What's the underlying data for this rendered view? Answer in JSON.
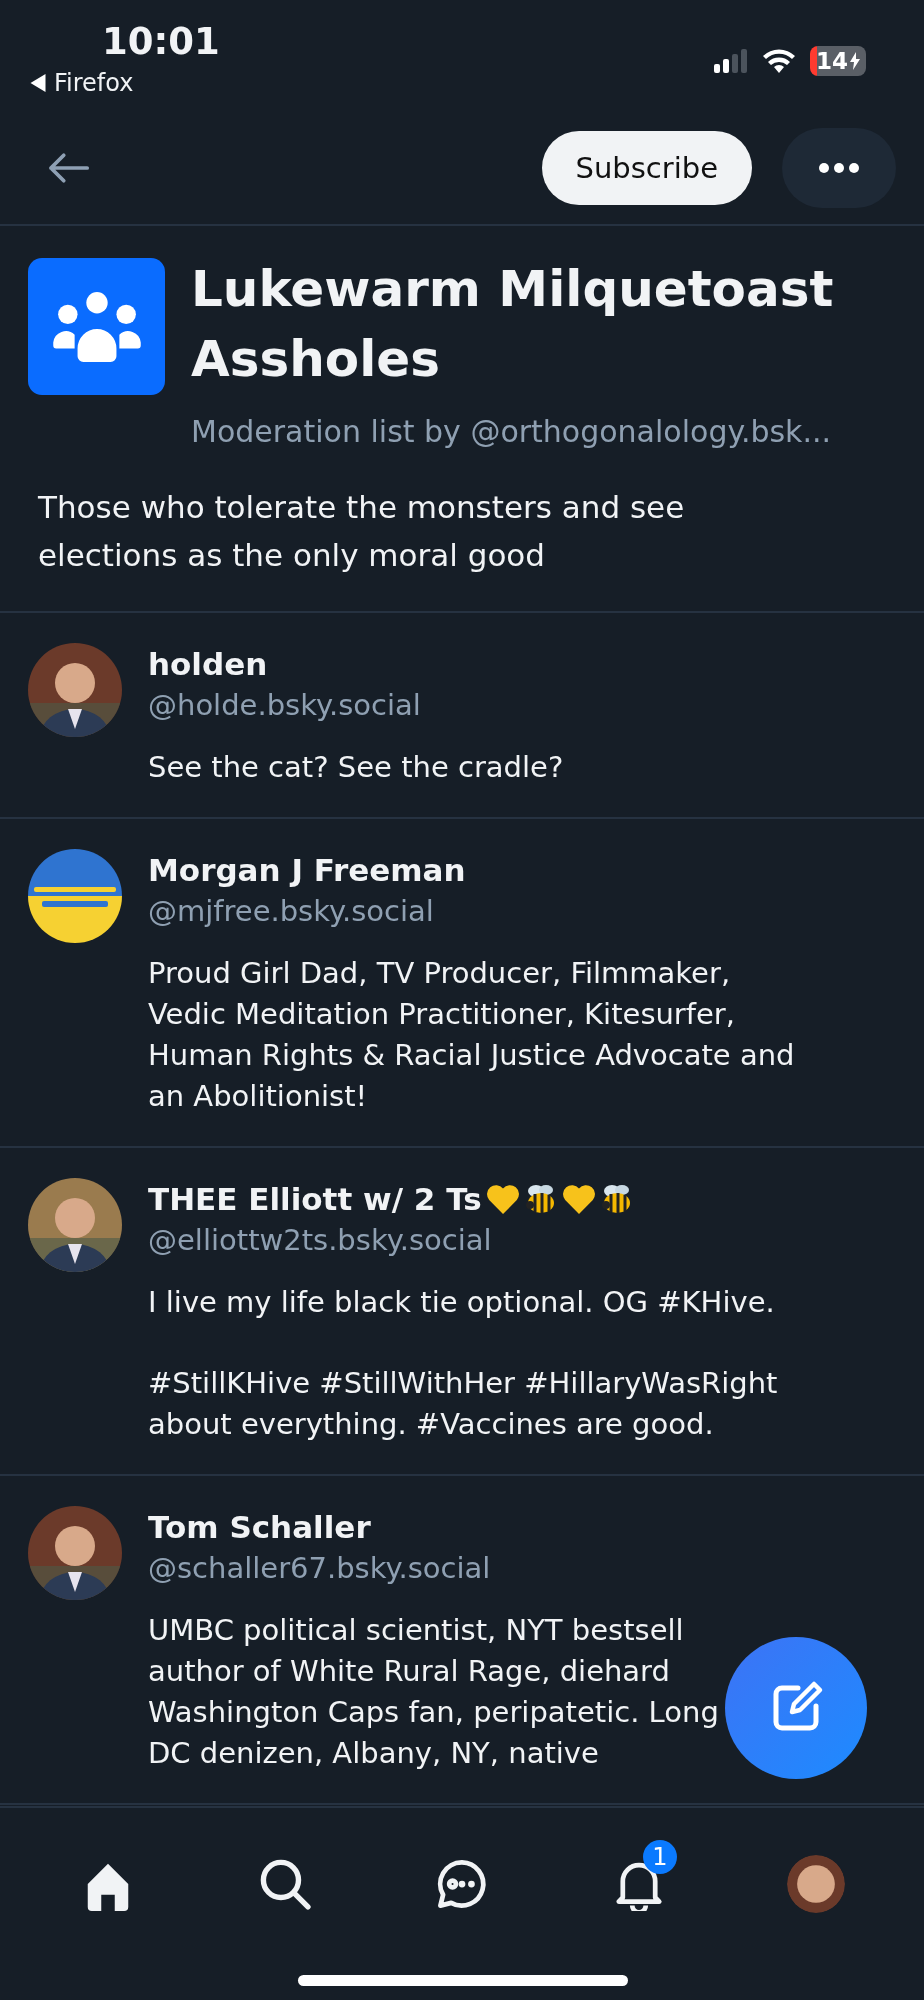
{
  "status_bar": {
    "time": "10:01",
    "back_app": "Firefox",
    "battery": "14",
    "battery_low": true,
    "charging": true
  },
  "header": {
    "subscribe": "Subscribe"
  },
  "list": {
    "title": "Lukewarm Milquetoast Assholes",
    "byline": "Moderation list by @orthogonalology.bsk...",
    "description": "Those who tolerate the monsters and see elections as the only moral good"
  },
  "members": [
    {
      "name": "holden",
      "handle": "@holde.bsky.social",
      "avatar": {
        "kind": "picture"
      },
      "bio": [
        [
          "See the cat? See the cradle?"
        ]
      ]
    },
    {
      "name": "Morgan J Freeman",
      "handle": "@mjfree.bsky.social",
      "avatar": {
        "kind": "flag"
      },
      "bio": [
        [
          "Proud Girl Dad, TV Producer, Filmmaker,",
          "Vedic Meditation Practitioner, Kitesurfer,",
          "Human Rights & Racial Justice Advocate and",
          "an Abolitionist!"
        ]
      ]
    },
    {
      "name": "THEE Elliott w/ 2 Ts",
      "emoji": [
        {
          "kind": "heart"
        },
        {
          "kind": "bee"
        },
        {
          "kind": "heart"
        },
        {
          "kind": "bee"
        }
      ],
      "handle": "@elliottw2ts.bsky.social",
      "avatar": {
        "kind": "picture"
      },
      "bio": [
        [
          "I live my life black tie optional. OG #KHive."
        ],
        [
          "#StillKHive #StillWithHer #HillaryWasRight",
          "about everything. #Vaccines are good."
        ]
      ]
    },
    {
      "name": "Tom Schaller",
      "handle": "@schaller67.bsky.social",
      "avatar": {
        "kind": "picture"
      },
      "bio": [
        [
          "UMBC political scientist, NYT bestsell",
          "author of White Rural Rage, diehard",
          "Washington Caps fan, peripatetic. Long",
          "DC denizen, Albany, NY, native"
        ]
      ]
    }
  ],
  "tab_bar": {
    "items": [
      {
        "kind": "home",
        "selected": true
      },
      {
        "kind": "search",
        "selected": false
      },
      {
        "kind": "chat",
        "selected": false
      },
      {
        "kind": "bell",
        "selected": false,
        "badge": "1"
      },
      {
        "kind": "avatar",
        "selected": false
      }
    ]
  }
}
